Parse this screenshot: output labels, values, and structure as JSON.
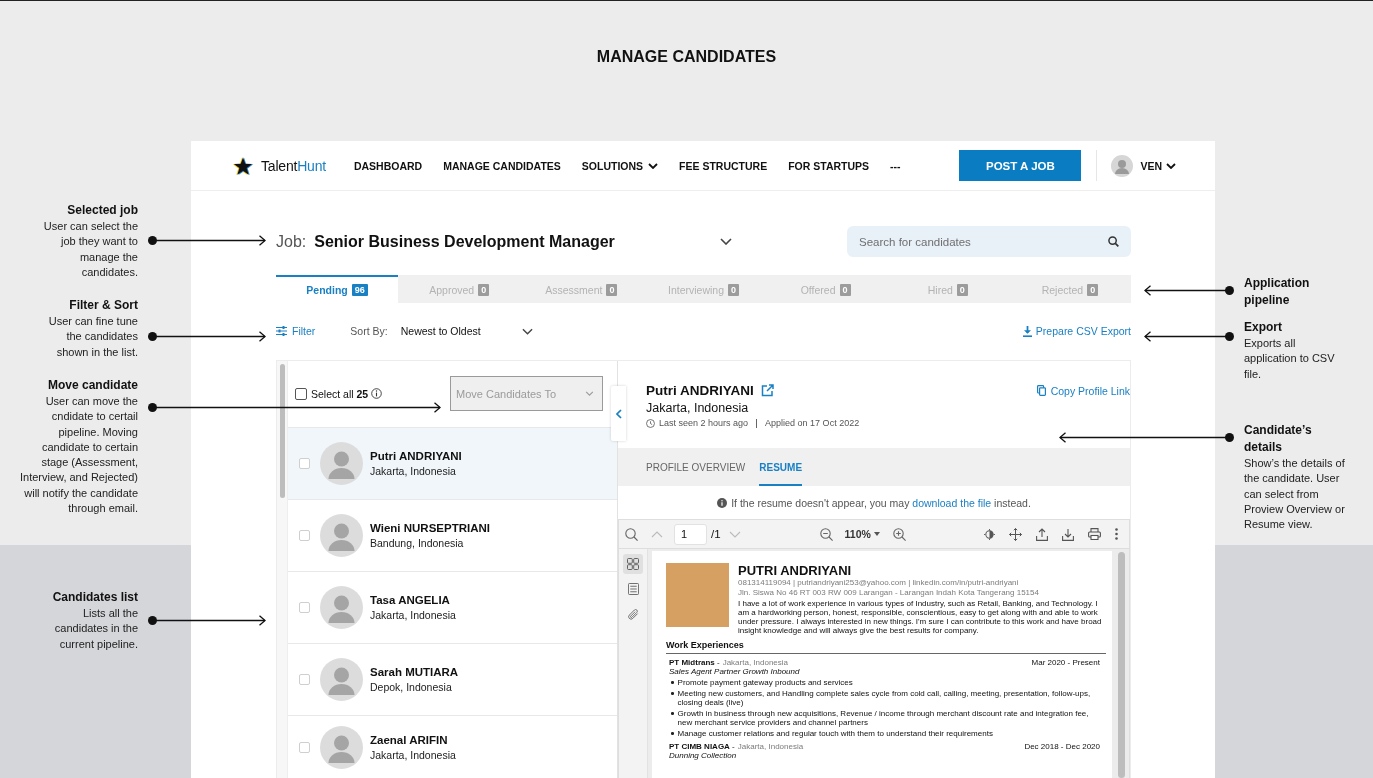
{
  "page": {
    "title": "MANAGE CANDIDATES"
  },
  "callouts": {
    "left": [
      {
        "title": "Selected job",
        "text": "User can select the job they want to manage the candidates."
      },
      {
        "title": "Filter & Sort",
        "text": "User can fine tune the candidates shown in the list."
      },
      {
        "title": "Move candidate",
        "text": "User can move the cndidate to certail pipeline. Moving candidate to certain stage (Assessment, Interview, and Rejected) will notify the candidate through email."
      },
      {
        "title": "Candidates list",
        "text": "Lists all the candidates in the current pipeline."
      }
    ],
    "right": [
      {
        "title": "Application pipeline"
      },
      {
        "title": "Export",
        "text": "Exports all application to CSV file."
      },
      {
        "title": "Candidate’s details",
        "text": "Show’s the details of the candidate. User can select from Proview Overview or Resume view."
      }
    ]
  },
  "nav": {
    "logo_dark": "Talent",
    "logo_accent": "Hunt",
    "menu": [
      {
        "label": "DASHBOARD",
        "dropdown": false
      },
      {
        "label": "MANAGE CANDIDATES",
        "dropdown": false
      },
      {
        "label": "SOLUTIONS",
        "dropdown": true
      },
      {
        "label": "FEE STRUCTURE",
        "dropdown": false
      },
      {
        "label": "FOR STARTUPS",
        "dropdown": false
      },
      {
        "label": "---",
        "dropdown": false
      }
    ],
    "post_button": "POST A JOB",
    "user": "VEN"
  },
  "job": {
    "label": "Job:",
    "title": "Senior Business Development Manager"
  },
  "search": {
    "placeholder": "Search for candidates"
  },
  "pipeline_tabs": [
    {
      "label": "Pending",
      "count": "96",
      "selected": true
    },
    {
      "label": "Approved",
      "count": "0",
      "selected": false
    },
    {
      "label": "Assessment",
      "count": "0",
      "selected": false
    },
    {
      "label": "Interviewing",
      "count": "0",
      "selected": false
    },
    {
      "label": "Offered",
      "count": "0",
      "selected": false
    },
    {
      "label": "Hired",
      "count": "0",
      "selected": false
    },
    {
      "label": "Rejected",
      "count": "0",
      "selected": false
    }
  ],
  "toolbar": {
    "filter": "Filter",
    "sort_label": "Sort By:",
    "sort_value": "Newest to Oldest",
    "export": "Prepare CSV Export"
  },
  "candidate_list": {
    "select_all": {
      "label": "Select all **25**",
      "checked": false
    },
    "move_to": {
      "placeholder": "Move Candidates To",
      "disabled": true
    },
    "candidates": [
      {
        "name": "Putri ANDRIYANI",
        "location": "Jakarta, Indonesia",
        "selected": true,
        "checked": false
      },
      {
        "name": "Wieni NURSEPTRIANI",
        "location": "Bandung, Indonesia",
        "selected": false,
        "checked": false
      },
      {
        "name": "Tasa ANGELIA",
        "location": "Jakarta, Indonesia",
        "selected": false,
        "checked": false
      },
      {
        "name": "Sarah MUTIARA",
        "location": "Depok, Indonesia",
        "selected": false,
        "checked": false
      },
      {
        "name": "Zaenal ARIFIN",
        "location": "Jakarta, Indonesia",
        "selected": false,
        "checked": false
      }
    ]
  },
  "details": {
    "name": "Putri ANDRIYANI",
    "location": "Jakarta, Indonesia",
    "last_seen": "Last seen 2 hours ago",
    "applied": "Applied on 17 Oct 2022",
    "copy_link": "Copy Profile Link",
    "tabs": [
      {
        "label": "PROFILE OVERVIEW",
        "selected": false
      },
      {
        "label": "RESUME",
        "selected": true
      }
    ],
    "notice": {
      "before": "If the resume doesn't appear, you may",
      "link": "download the file",
      "after": "instead."
    }
  },
  "viewer": {
    "page": "1",
    "page_total": "/1",
    "zoom": "110%",
    "sidebar": [
      {
        "kind": "thumbnails",
        "selected": true
      },
      {
        "kind": "outline",
        "selected": false
      },
      {
        "kind": "attachments",
        "selected": false
      }
    ]
  },
  "resume": {
    "name": "PUTRI ANDRIYANI",
    "contact": "081314119094 | putriandriyani253@yahoo.com | linkedin.com/in/putri-andriyani",
    "address": "Jln. Siswa No 46 RT 003 RW 009 Larangan - Larangan Indah Kota Tangerang 15154",
    "summary": "I have a lot of work experience in various types of Industry, such as Retail, Banking, and Technology. I am a hardworking person, honest, responsible, conscientious, easy to get along with and able to work under pressure. I always interested in new things. I'm sure I can contribute to this work and have broad insight knowledge and will always give the best results for company.",
    "section_title": "Work Experiences",
    "experiences": [
      {
        "company": "**PT Midtrans** -",
        "location": "Jakarta, Indonesia",
        "period": "Mar 2020 - Present",
        "role": "Sales Agent Partner Growth Inbound",
        "duties": [
          "Promote payment gateway products and services",
          "Meeting new customers, and Handling complete sales cycle from cold call, calling, meeting, presentation, follow-ups, closing deals (live)",
          "Growth in business through new acquisitions, Revenue / income through merchant discount rate and integration fee, new merchant service providers and channel partners",
          "Manage customer relations and regular touch with them to understand their requirements"
        ]
      },
      {
        "company": "**PT CIMB NIAGA** -",
        "location": "Jakarta, Indonesia",
        "period": "Dec 2018 - Dec 2020",
        "role": "Dunning Collection"
      }
    ]
  }
}
